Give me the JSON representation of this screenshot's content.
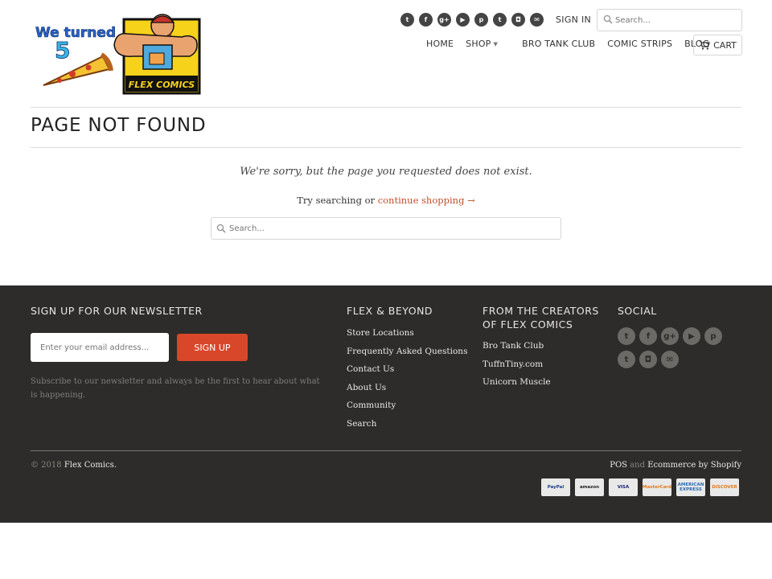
{
  "header": {
    "logo_alt": "We turned 5 FLEX COMICS",
    "logo_text_top": "We turned",
    "logo_number": "5",
    "logo_brand": "FLEX COMICS",
    "social_icons": [
      {
        "name": "twitter-icon",
        "glyph": "t"
      },
      {
        "name": "facebook-icon",
        "glyph": "f"
      },
      {
        "name": "google-plus-icon",
        "glyph": "g+"
      },
      {
        "name": "youtube-icon",
        "glyph": "▶"
      },
      {
        "name": "pinterest-icon",
        "glyph": "p"
      },
      {
        "name": "tumblr-icon",
        "glyph": "t"
      },
      {
        "name": "instagram-icon",
        "glyph": "◘"
      },
      {
        "name": "email-icon",
        "glyph": "✉"
      }
    ],
    "signin_label": "SIGN IN",
    "search_placeholder": "Search...",
    "nav": {
      "home": "HOME",
      "shop": "SHOP",
      "bro_tank_club": "BRO TANK CLUB",
      "comic_strips": "COMIC STRIPS",
      "blog": "BLOG"
    },
    "cart_label": "CART"
  },
  "main": {
    "title": "PAGE NOT FOUND",
    "sorry_text": "We're sorry, but the page you requested does not exist.",
    "try_text": "Try searching or",
    "continue_link": "continue shopping →",
    "search_placeholder": "Search..."
  },
  "footer": {
    "newsletter_heading": "SIGN UP FOR OUR NEWSLETTER",
    "email_placeholder": "Enter your email address...",
    "signup_label": "SIGN UP",
    "subscribe_text": "Subscribe to our newsletter and always be the first to hear about what is happening.",
    "flex_heading": "FLEX & BEYOND",
    "flex_links": [
      "Store Locations",
      "Frequently Asked Questions",
      "Contact Us",
      "About Us",
      "Community",
      "Search"
    ],
    "creators_heading_line1": "FROM THE CREATORS",
    "creators_heading_line2": "OF FLEX COMICS",
    "creators_links": [
      "Bro Tank Club",
      "TuffnTiny.com",
      "Unicorn Muscle"
    ],
    "social_heading": "SOCIAL",
    "social_icons": [
      {
        "name": "twitter-icon",
        "glyph": "t"
      },
      {
        "name": "facebook-icon",
        "glyph": "f"
      },
      {
        "name": "google-plus-icon",
        "glyph": "g+"
      },
      {
        "name": "youtube-icon",
        "glyph": "▶"
      },
      {
        "name": "pinterest-icon",
        "glyph": "p"
      },
      {
        "name": "tumblr-icon",
        "glyph": "t"
      },
      {
        "name": "instagram-icon",
        "glyph": "◘"
      },
      {
        "name": "email-icon",
        "glyph": "✉"
      }
    ],
    "copyright_prefix": "© 2018",
    "copyright_brand": "Flex Comics.",
    "pos": "POS",
    "and": "and",
    "ecommerce": "Ecommerce by Shopify",
    "payments": [
      {
        "name": "paypal-icon",
        "label": "PayPal",
        "color": "#1a3e8a"
      },
      {
        "name": "amazon-icon",
        "label": "amazon",
        "color": "#222222"
      },
      {
        "name": "visa-icon",
        "label": "VISA",
        "color": "#1a1f71"
      },
      {
        "name": "mastercard-icon",
        "label": "MasterCard",
        "color": "#e07a1e"
      },
      {
        "name": "amex-icon",
        "label": "AMERICAN EXPRESS",
        "color": "#2a6db3"
      },
      {
        "name": "discover-icon",
        "label": "DISCOVER",
        "color": "#e07a1e"
      }
    ]
  },
  "colors": {
    "accent": "#d8472a",
    "link": "#c24e2c",
    "footer_bg": "#2d2c2a"
  }
}
